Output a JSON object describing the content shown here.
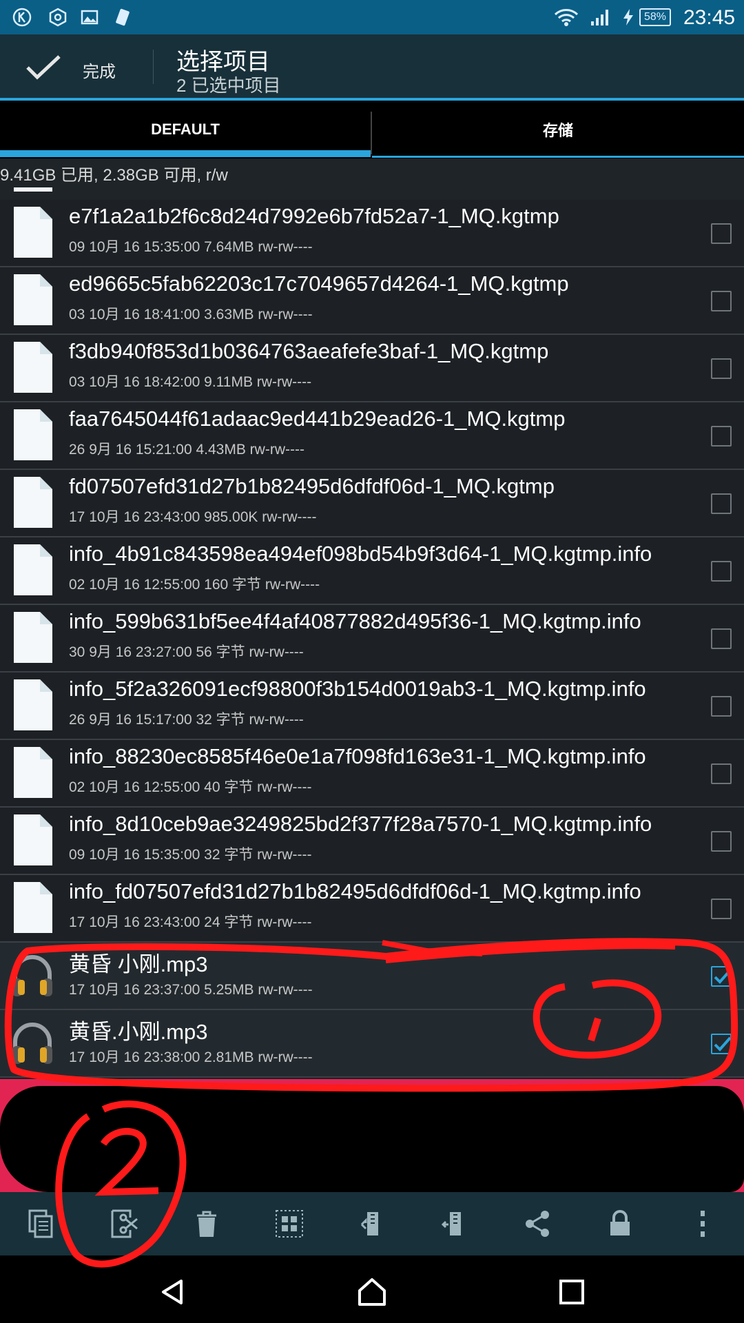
{
  "status_bar": {
    "battery": "58%",
    "time": "23:45"
  },
  "action_bar": {
    "done_label": "完成",
    "title": "选择项目",
    "subtitle": "2 已选中项目"
  },
  "tabs": [
    {
      "label": "DEFAULT"
    },
    {
      "label": "存储"
    }
  ],
  "storage_info": "9.41GB 已用, 2.38GB 可用, r/w",
  "files": [
    {
      "name": "e7f1a2a1b2f6c8d24d7992e6b7fd52a7-1_MQ.kgtmp",
      "meta": "09 10月 16 15:35:00  7.64MB  rw-rw----",
      "type": "file",
      "checked": false
    },
    {
      "name": "ed9665c5fab62203c17c7049657d4264-1_MQ.kgtmp",
      "meta": "03 10月 16 18:41:00  3.63MB  rw-rw----",
      "type": "file",
      "checked": false
    },
    {
      "name": "f3db940f853d1b0364763aeafefe3baf-1_MQ.kgtmp",
      "meta": "03 10月 16 18:42:00  9.11MB  rw-rw----",
      "type": "file",
      "checked": false
    },
    {
      "name": "faa7645044f61adaac9ed441b29ead26-1_MQ.kgtmp",
      "meta": "26 9月 16 15:21:00  4.43MB  rw-rw----",
      "type": "file",
      "checked": false
    },
    {
      "name": "fd07507efd31d27b1b82495d6dfdf06d-1_MQ.kgtmp",
      "meta": "17 10月 16 23:43:00  985.00K  rw-rw----",
      "type": "file",
      "checked": false
    },
    {
      "name": "info_4b91c843598ea494ef098bd54b9f3d64-1_MQ.kgtmp.info",
      "meta": "02 10月 16 12:55:00  160 字节  rw-rw----",
      "type": "file",
      "checked": false
    },
    {
      "name": "info_599b631bf5ee4f4af40877882d495f36-1_MQ.kgtmp.info",
      "meta": "30 9月 16 23:27:00  56 字节  rw-rw----",
      "type": "file",
      "checked": false
    },
    {
      "name": "info_5f2a326091ecf98800f3b154d0019ab3-1_MQ.kgtmp.info",
      "meta": "26 9月 16 15:17:00  32 字节  rw-rw----",
      "type": "file",
      "checked": false
    },
    {
      "name": "info_88230ec8585f46e0e1a7f098fd163e31-1_MQ.kgtmp.info",
      "meta": "02 10月 16 12:55:00  40 字节  rw-rw----",
      "type": "file",
      "checked": false
    },
    {
      "name": "info_8d10ceb9ae3249825bd2f377f28a7570-1_MQ.kgtmp.info",
      "meta": "09 10月 16 15:35:00  32 字节  rw-rw----",
      "type": "file",
      "checked": false
    },
    {
      "name": "info_fd07507efd31d27b1b82495d6dfdf06d-1_MQ.kgtmp.info",
      "meta": "17 10月 16 23:43:00  24 字节  rw-rw----",
      "type": "file",
      "checked": false
    },
    {
      "name": "黄昏  小刚.mp3",
      "meta": "17 10月 16 23:37:00  5.25MB  rw-rw----",
      "type": "audio",
      "checked": true
    },
    {
      "name": "黄昏.小刚.mp3",
      "meta": "17 10月 16 23:38:00  2.81MB  rw-rw----",
      "type": "audio",
      "checked": true
    }
  ],
  "annotations": [
    "1",
    "2"
  ],
  "colors": {
    "accent": "#2aa5dd",
    "bar": "#183039",
    "annotation": "#ff1a1a"
  },
  "toolbar_icons": [
    "copy-icon",
    "cut-icon",
    "delete-icon",
    "select-all-icon",
    "compress-icon",
    "extract-icon",
    "share-icon",
    "lock-icon",
    "more-icon"
  ]
}
